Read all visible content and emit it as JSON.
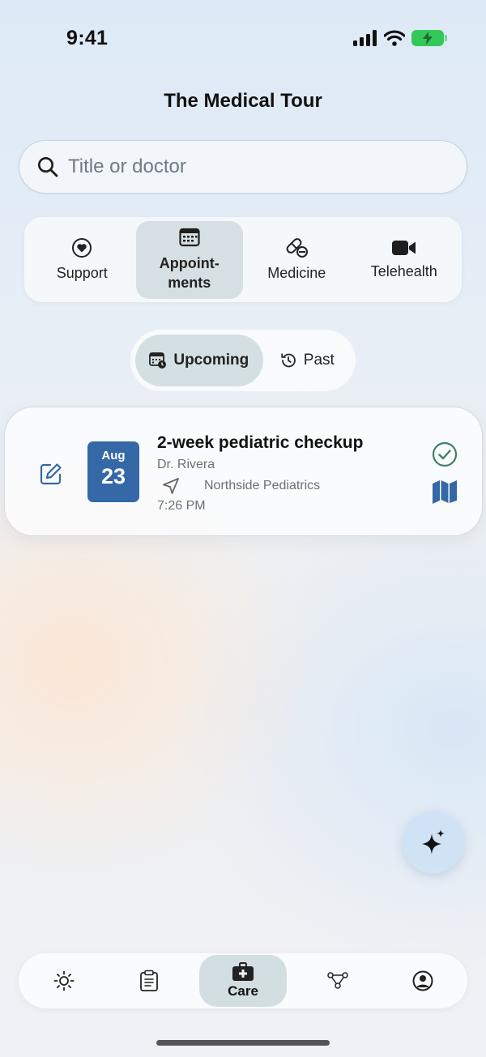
{
  "status_bar": {
    "time": "9:41"
  },
  "header": {
    "title": "The Medical Tour"
  },
  "search": {
    "placeholder": "Title or doctor",
    "value": ""
  },
  "categories": [
    {
      "label": "Support",
      "icon": "heart-circle-icon"
    },
    {
      "label": "Appoint-\nments",
      "icon": "calendar-icon",
      "selected": true
    },
    {
      "label": "Medicine",
      "icon": "pills-icon"
    },
    {
      "label": "Telehealth",
      "icon": "video-camera-icon"
    }
  ],
  "segments": {
    "upcoming": "Upcoming",
    "past": "Past",
    "selected": "upcoming"
  },
  "appointment": {
    "month": "Aug",
    "day": "23",
    "title": "2-week pediatric checkup",
    "doctor": "Dr. Rivera",
    "location": "Northside Pediatrics",
    "time": "7:26 PM",
    "status": "confirmed"
  },
  "tabbar": {
    "items": [
      {
        "icon": "sun-icon"
      },
      {
        "icon": "clipboard-icon"
      },
      {
        "icon": "medical-kit-icon",
        "label": "Care",
        "selected": true
      },
      {
        "icon": "graph-nodes-icon"
      },
      {
        "icon": "profile-icon"
      }
    ],
    "care_label": "Care"
  },
  "colors": {
    "accent": "#3568a6",
    "check": "#3f7f66",
    "battery": "#34c759"
  }
}
